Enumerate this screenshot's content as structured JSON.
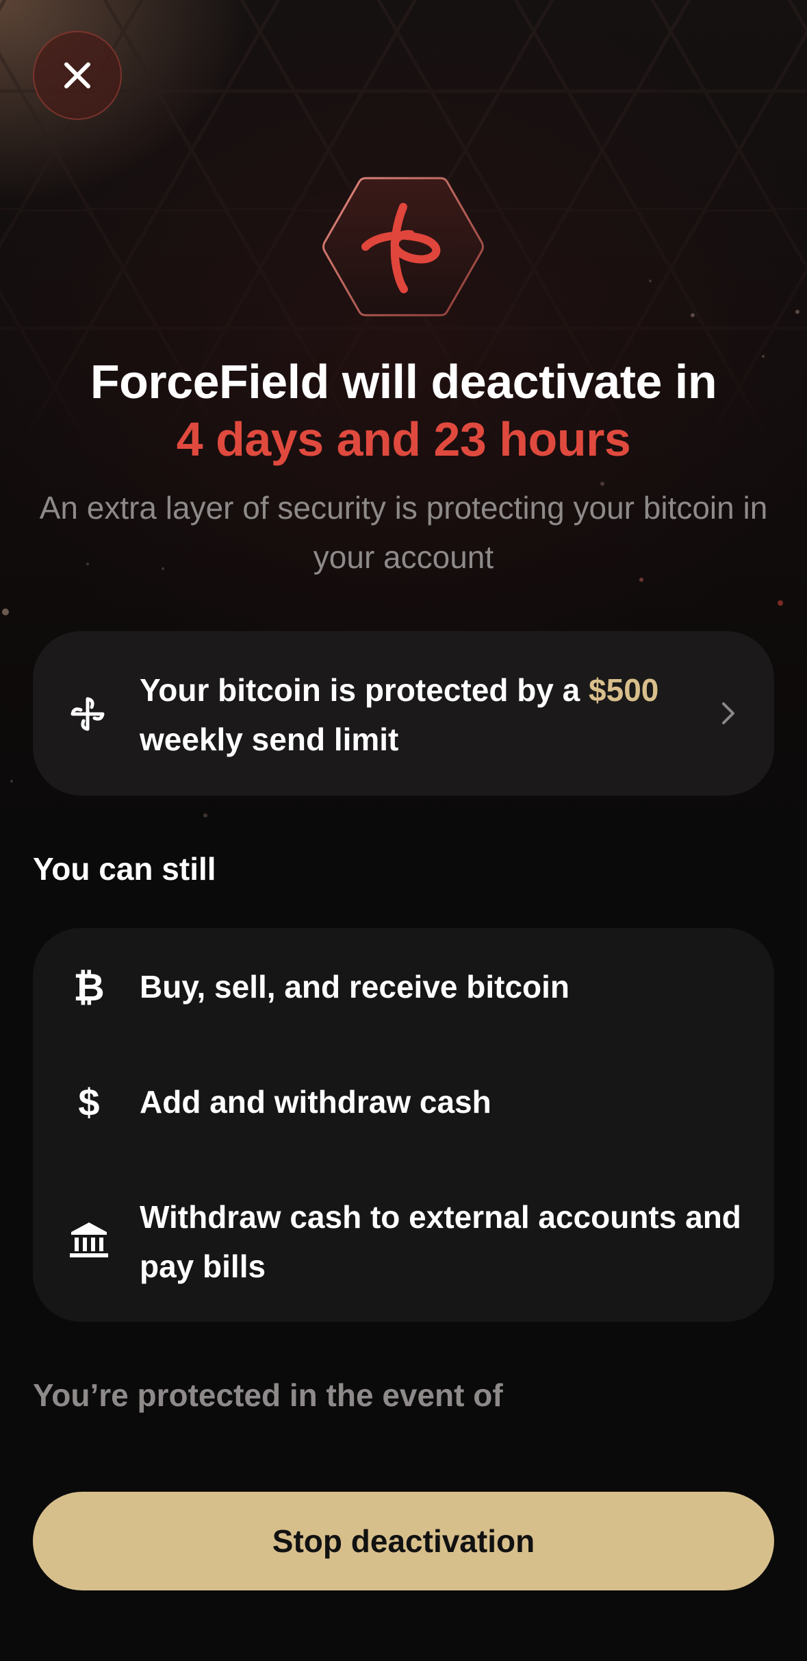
{
  "header": {
    "close_icon": "close-icon",
    "logo_icon": "forcefield-logo-icon"
  },
  "hero": {
    "title": "ForceField will deactivate in",
    "countdown": "4 days and 23 hours",
    "subtitle": "An extra layer of security is protecting your bitcoin in your account"
  },
  "limit_card": {
    "icon": "pinwheel-icon",
    "text_before": "Your bitcoin is protected by a ",
    "amount": "$500",
    "text_after": " weekly send limit",
    "chevron_icon": "chevron-right-icon"
  },
  "still": {
    "label": "You can still",
    "items": [
      {
        "icon": "bitcoin-icon",
        "glyph": "₿",
        "label": "Buy, sell, and receive bitcoin"
      },
      {
        "icon": "dollar-icon",
        "glyph": "$",
        "label": "Add and withdraw cash"
      },
      {
        "icon": "bank-icon",
        "glyph": "",
        "label": "Withdraw cash to external accounts and pay bills"
      }
    ]
  },
  "protected": {
    "label": "You’re protected in the event of"
  },
  "cta": {
    "label": "Stop deactivation"
  },
  "colors": {
    "accent_red": "#e04a3e",
    "gold": "#d7bf8c",
    "card": "#1b1919",
    "background": "#0a0a0a",
    "muted_text": "#8e8a8a"
  }
}
